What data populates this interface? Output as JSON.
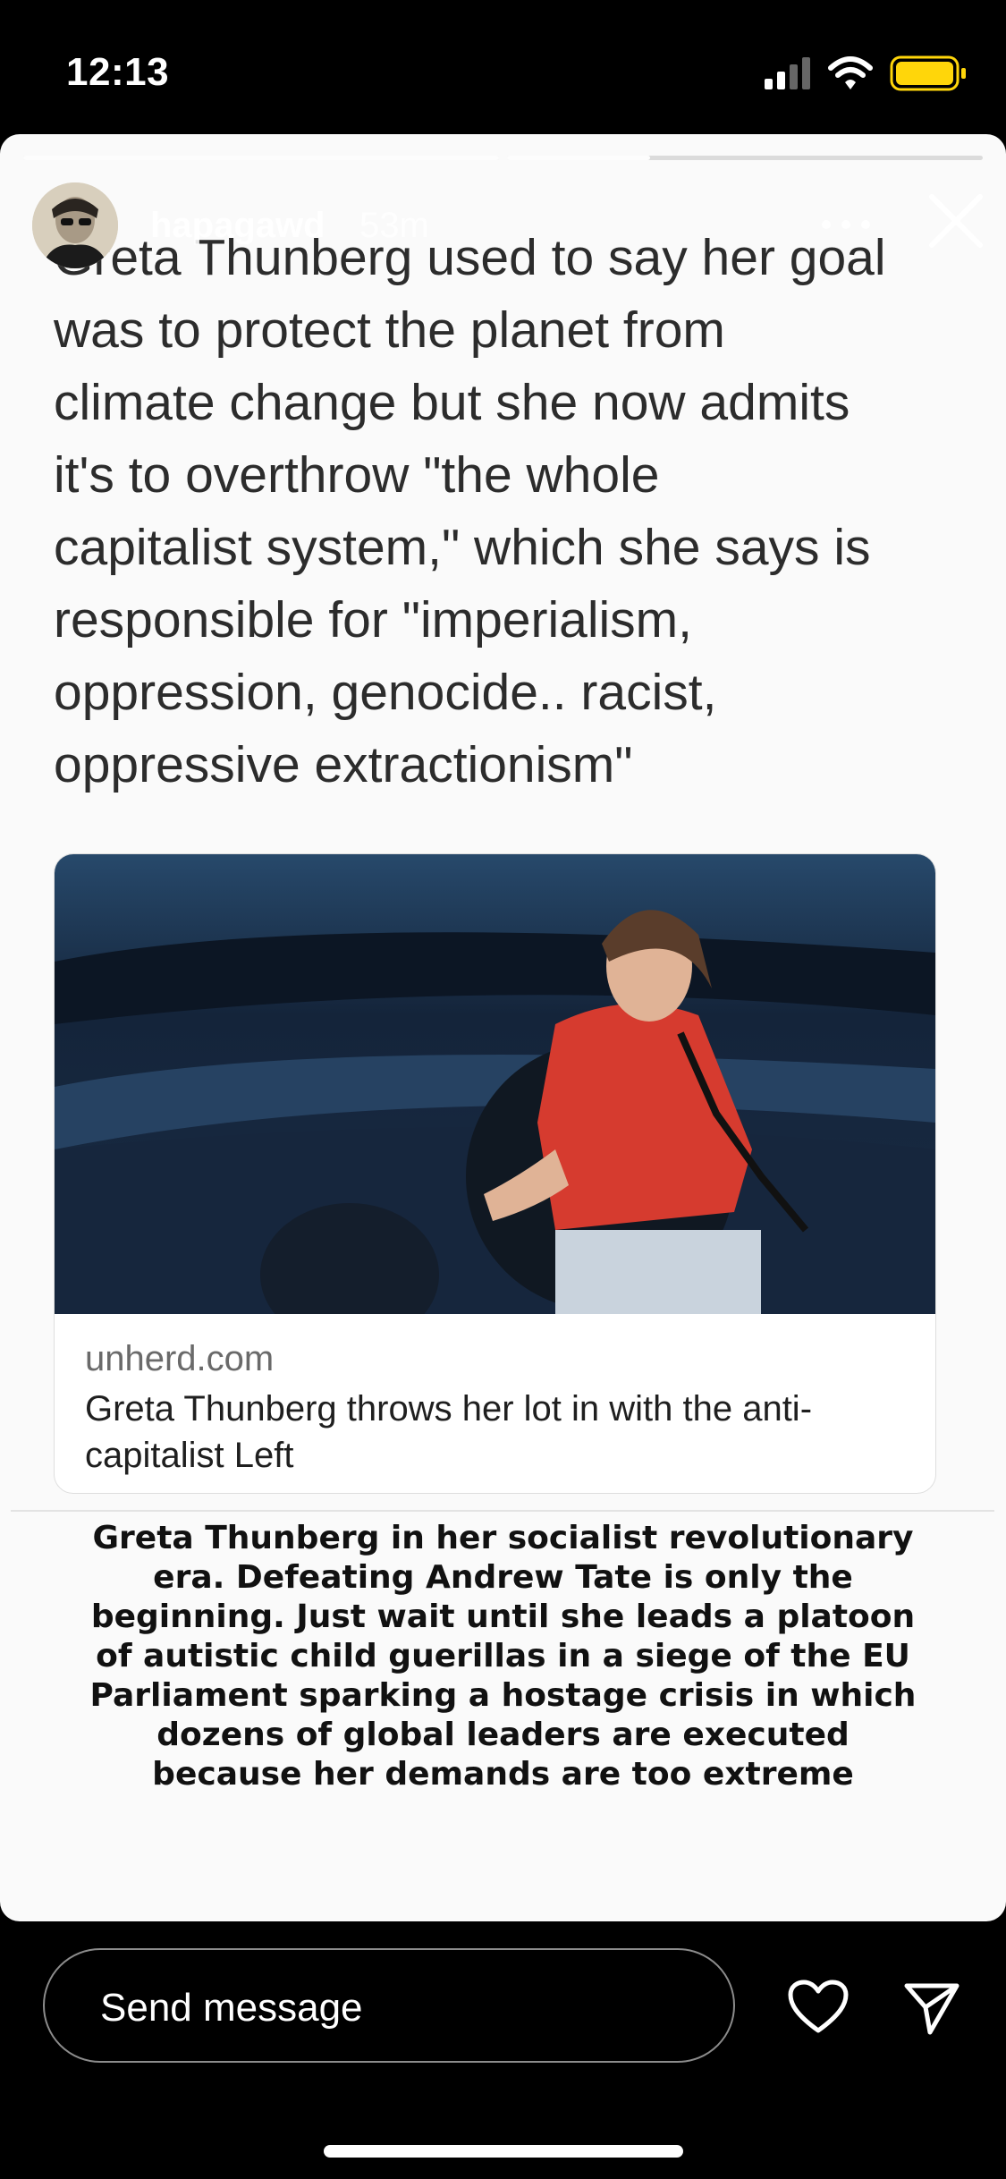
{
  "status_bar": {
    "time": "12:13"
  },
  "story": {
    "username": "hapagawd",
    "age": "53m",
    "progress": {
      "segments": 2,
      "current_segment": 2,
      "current_fraction": 0.3
    },
    "tweet_lines": [
      "Greta Thunberg used to say her goal",
      "was to protect the planet from",
      "climate change but she now admits",
      "it's to overthrow \"the whole",
      "capitalist system,\" which she says is",
      "responsible for \"imperialism,",
      "oppression, genocide.. racist,",
      "oppressive extractionism\""
    ],
    "link_card": {
      "domain": "unherd.com",
      "title": "Greta Thunberg throws her lot in with the anti-capitalist Left"
    },
    "caption_lines": [
      "Greta Thunberg in her socialist revolutionary",
      "era. Defeating Andrew Tate is only the",
      "beginning. Just wait until she leads a platoon",
      "of autistic child guerillas in a siege of the EU",
      "Parliament sparking a hostage crisis in which",
      "dozens of global leaders are executed",
      "because her demands are too extreme"
    ]
  },
  "reply": {
    "placeholder": "Send message"
  },
  "icons": [
    "signal-icon",
    "wifi-icon",
    "battery-icon",
    "more-icon",
    "close-icon",
    "heart-icon",
    "send-icon"
  ],
  "colors": {
    "battery": "#FFD60A",
    "background": "#000000",
    "story_bg": "#fafafa"
  }
}
